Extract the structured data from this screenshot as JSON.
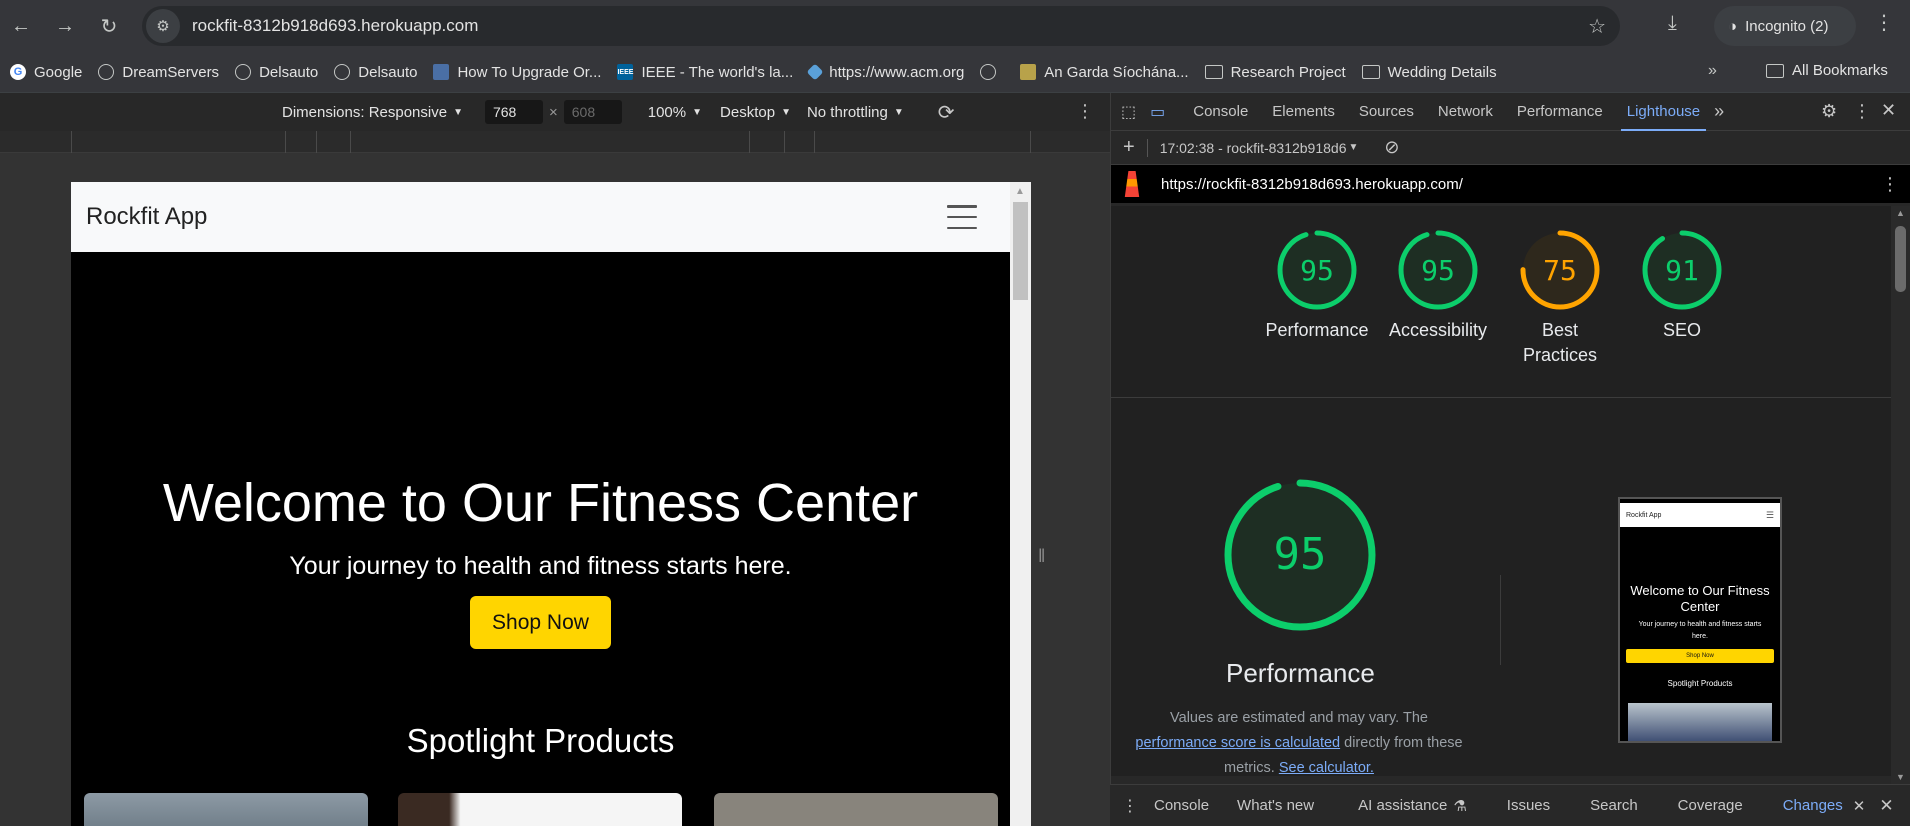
{
  "browser": {
    "url": "rockfit-8312b918d693.herokuapp.com",
    "incognito_label": "Incognito (2)",
    "bookmarks": [
      "Google",
      "DreamServers",
      "Delsauto",
      "Delsauto",
      "How To Upgrade Or...",
      "IEEE - The world's la...",
      "https://www.acm.org",
      "",
      "An Garda Síochána...",
      "Research Project",
      "Wedding Details"
    ],
    "all_bookmarks": "All Bookmarks"
  },
  "device_toolbar": {
    "dimensions": "Dimensions: Responsive",
    "width": "768",
    "height_placeholder": "608",
    "zoom": "100%",
    "device_type": "Desktop",
    "throttling": "No throttling"
  },
  "site": {
    "brand": "Rockfit App",
    "hero_title": "Welcome to Our Fitness Center",
    "hero_subtitle": "Your journey to health and fitness starts here.",
    "cta": "Shop Now",
    "section_title": "Spotlight Products"
  },
  "devtools": {
    "tabs": [
      "Console",
      "Elements",
      "Sources",
      "Network",
      "Performance",
      "Lighthouse"
    ],
    "active_tab": "Lighthouse",
    "report_select": "17:02:38 - rockfit-8312b918d6",
    "report_url": "https://rockfit-8312b918d693.herokuapp.com/",
    "scores": [
      {
        "label": "Performance",
        "score": "95",
        "color": "#0cce6b"
      },
      {
        "label": "Accessibility",
        "score": "95",
        "color": "#0cce6b"
      },
      {
        "label": "Best Practices",
        "score": "75",
        "color": "#ffa400"
      },
      {
        "label": "SEO",
        "score": "91",
        "color": "#0cce6b"
      }
    ],
    "big_score": "95",
    "big_label": "Performance",
    "note_1": "Values are estimated and may vary. The",
    "note_link": "performance score is calculated",
    "note_2": "directly from these",
    "note_3": "metrics.",
    "note_link2": "See calculator.",
    "thumb": {
      "brand": "Rockfit App",
      "title": "Welcome to Our Fitness Center",
      "subtitle": "Your journey to health and fitness starts here.",
      "cta": "Shop Now",
      "section": "Spotlight Products"
    },
    "drawer_tabs": [
      "Console",
      "What's new",
      "AI assistance",
      "Issues",
      "Search",
      "Coverage",
      "Changes"
    ],
    "drawer_active": "Changes"
  }
}
